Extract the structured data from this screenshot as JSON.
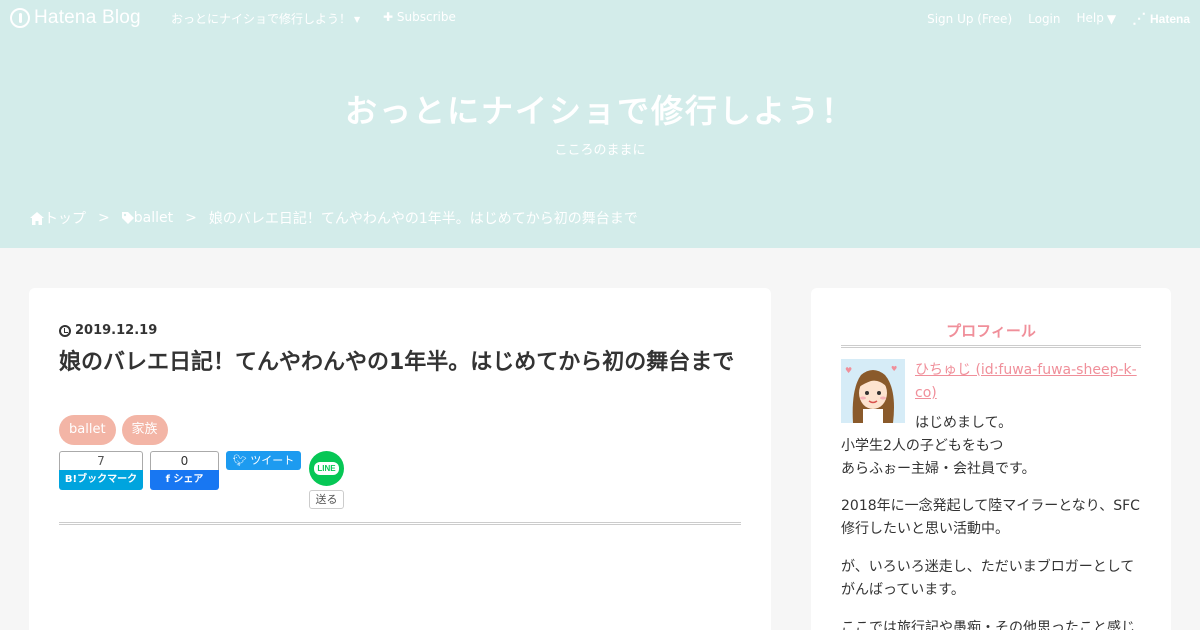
{
  "topbar": {
    "logo_text": "Hatena Blog",
    "blog_name": "おっとにナイショで修行しよう！",
    "subscribe": "Subscribe",
    "signup": "Sign Up (Free)",
    "login": "Login",
    "help": "Help",
    "hatena": "Hatena"
  },
  "blog": {
    "title": "おっとにナイショで修行しよう！",
    "description": "こころのままに"
  },
  "breadcrumb": {
    "home": "トップ",
    "category": "ballet",
    "current": "娘のバレエ日記！てんやわんやの1年半。はじめてから初の舞台まで",
    "separator": ">"
  },
  "article": {
    "date": "2019.12.19",
    "title": "娘のバレエ日記！てんやわんやの1年半。はじめてから初の舞台まで",
    "tags": [
      "ballet",
      "家族"
    ],
    "share": {
      "hatena_count": "7",
      "hatena_label": "B!ブックマーク",
      "facebook_count": "0",
      "facebook_label": "f シェア",
      "tweet_label": "ツイート",
      "line_icon": "LINE",
      "line_send": "送る"
    }
  },
  "sidebar": {
    "profile_heading": "プロフィール",
    "profile_name": "ひちゅじ (id:fuwa-fuwa-sheep-k-co)",
    "profile_lines": [
      "はじめまして。",
      "小学生2人の子どもをもつ",
      "あらふぉー主婦・会社員です。",
      "2018年に一念発起して陸マイラーとなり、SFC",
      "修行したいと思い活動中。",
      "が、いろいろ迷走し、ただいまブロガーとして",
      "がんばっています。",
      "ここでは旅行記や愚痴・その他思ったこと感じ"
    ]
  },
  "colors": {
    "header_bg": "#d3ecea",
    "tag_bg": "#f3b5a6",
    "accent_pink": "#f08f9a",
    "page_bg": "#f6f6f6"
  },
  "icons": [
    "hatena-logo-icon",
    "plus-icon",
    "home-icon",
    "tag-icon",
    "clock-icon",
    "twitter-icon",
    "facebook-icon",
    "line-icon"
  ]
}
